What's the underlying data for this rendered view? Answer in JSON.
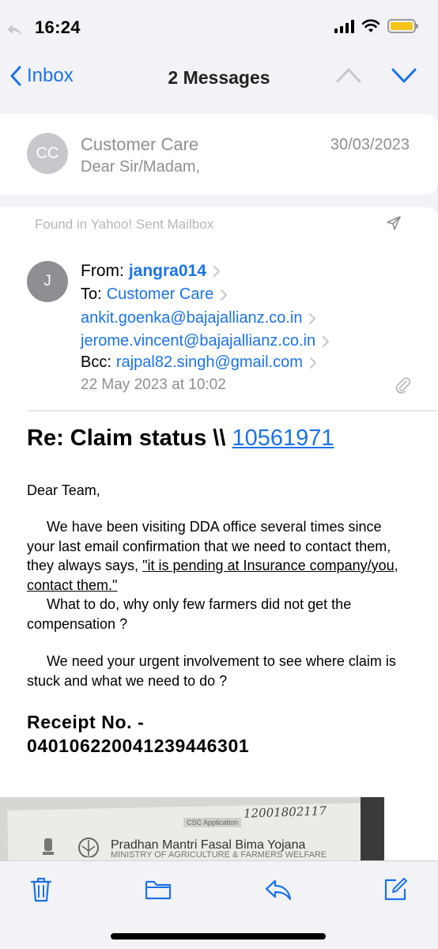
{
  "status_bar": {
    "time": "16:24",
    "battery_color": "#f5c518"
  },
  "nav": {
    "back_label": "Inbox",
    "title": "2 Messages"
  },
  "previous_message": {
    "avatar_initials": "CC",
    "sender": "Customer Care",
    "date": "30/03/2023",
    "snippet": "Dear Sir/Madam,"
  },
  "message": {
    "found_in": "Found in Yahoo! Sent Mailbox",
    "avatar_initial": "J",
    "from_label": "From:",
    "from": "jangra014",
    "to_label": "To:",
    "to": "Customer Care",
    "cc": [
      "ankit.goenka@bajajallianz.co.in",
      "jerome.vincent@bajajallianz.co.in"
    ],
    "bcc_label": "Bcc:",
    "bcc": "rajpal82.singh@gmail.com",
    "date": "22 May 2023 at 10:02",
    "subject_prefix": "Re: Claim status \\\\ ",
    "subject_number": "10561971",
    "greeting": "Dear Team,",
    "para1_a": "We have been visiting DDA office several times since your last email confirmation that we need to contact them, they always says, ",
    "para1_quote": "\"it is pending at Insurance company/you, contact them.\"",
    "para1_b": "What to do, why only few farmers did not get the compensation ?",
    "para2": "We need your urgent involvement to see where claim is stuck and what we need to do ?",
    "receipt_label": "Receipt No. -",
    "receipt_number": "040106220041239446301",
    "attachment": {
      "header": "CSC Application",
      "handwritten": "12001802117",
      "scheme": "Pradhan Mantri Fasal Bima Yojana",
      "ministry": "MINISTRY OF AGRICULTURE & FARMERS WELFARE"
    }
  },
  "toolbar": {
    "icons": [
      "trash-icon",
      "folder-icon",
      "reply-icon",
      "compose-icon"
    ],
    "accent": "#1a73e8"
  }
}
